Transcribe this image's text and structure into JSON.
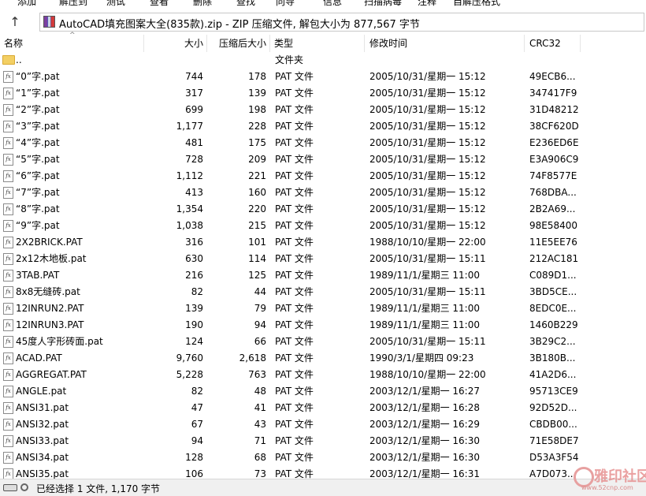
{
  "toolbar": {
    "items": [
      "添加",
      "解压到",
      "测试",
      "查看",
      "删除",
      "查找",
      "向导",
      "信息",
      "扫描病毒",
      "注释",
      "自解压格式"
    ]
  },
  "address": {
    "text": "AutoCAD填充图案大全(835款).zip - ZIP 压缩文件, 解包大小为 877,567 字节"
  },
  "columns": {
    "name": "名称",
    "size": "大小",
    "packed": "压缩后大小",
    "type": "类型",
    "modified": "修改时间",
    "crc": "CRC32"
  },
  "rows": [
    {
      "name": "..",
      "size": "",
      "packed": "",
      "type": "文件夹",
      "modified": "",
      "crc": "",
      "icon": "folder-icon"
    },
    {
      "name": "“0”字.pat",
      "size": "744",
      "packed": "178",
      "type": "PAT 文件",
      "modified": "2005/10/31/星期一 15:12",
      "crc": "49ECB6...",
      "icon": "pat-file-icon"
    },
    {
      "name": "“1”字.pat",
      "size": "317",
      "packed": "139",
      "type": "PAT 文件",
      "modified": "2005/10/31/星期一 15:12",
      "crc": "347417F9",
      "icon": "pat-file-icon"
    },
    {
      "name": "“2”字.pat",
      "size": "699",
      "packed": "198",
      "type": "PAT 文件",
      "modified": "2005/10/31/星期一 15:12",
      "crc": "31D48212",
      "icon": "pat-file-icon"
    },
    {
      "name": "“3”字.pat",
      "size": "1,177",
      "packed": "228",
      "type": "PAT 文件",
      "modified": "2005/10/31/星期一 15:12",
      "crc": "38CF620D",
      "icon": "pat-file-icon"
    },
    {
      "name": "“4”字.pat",
      "size": "481",
      "packed": "175",
      "type": "PAT 文件",
      "modified": "2005/10/31/星期一 15:12",
      "crc": "E236ED6E",
      "icon": "pat-file-icon"
    },
    {
      "name": "“5”字.pat",
      "size": "728",
      "packed": "209",
      "type": "PAT 文件",
      "modified": "2005/10/31/星期一 15:12",
      "crc": "E3A906C9",
      "icon": "pat-file-icon"
    },
    {
      "name": "“6”字.pat",
      "size": "1,112",
      "packed": "221",
      "type": "PAT 文件",
      "modified": "2005/10/31/星期一 15:12",
      "crc": "74F8577E",
      "icon": "pat-file-icon"
    },
    {
      "name": "“7”字.pat",
      "size": "413",
      "packed": "160",
      "type": "PAT 文件",
      "modified": "2005/10/31/星期一 15:12",
      "crc": "768DBA...",
      "icon": "pat-file-icon"
    },
    {
      "name": "“8”字.pat",
      "size": "1,354",
      "packed": "220",
      "type": "PAT 文件",
      "modified": "2005/10/31/星期一 15:12",
      "crc": "2B2A69...",
      "icon": "pat-file-icon"
    },
    {
      "name": "“9”字.pat",
      "size": "1,038",
      "packed": "215",
      "type": "PAT 文件",
      "modified": "2005/10/31/星期一 15:12",
      "crc": "98E58400",
      "icon": "pat-file-icon"
    },
    {
      "name": "2X2BRICK.PAT",
      "size": "316",
      "packed": "101",
      "type": "PAT 文件",
      "modified": "1988/10/10/星期一 22:00",
      "crc": "11E5EE76",
      "icon": "pat-file-icon"
    },
    {
      "name": "2x12木地板.pat",
      "size": "630",
      "packed": "114",
      "type": "PAT 文件",
      "modified": "2005/10/31/星期一 15:11",
      "crc": "212AC181",
      "icon": "pat-file-icon"
    },
    {
      "name": "3TAB.PAT",
      "size": "216",
      "packed": "125",
      "type": "PAT 文件",
      "modified": "1989/11/1/星期三 11:00",
      "crc": "C089D1...",
      "icon": "pat-file-icon"
    },
    {
      "name": "8x8无缝砖.pat",
      "size": "82",
      "packed": "44",
      "type": "PAT 文件",
      "modified": "2005/10/31/星期一 15:11",
      "crc": "3BD5CE...",
      "icon": "pat-file-icon"
    },
    {
      "name": "12INRUN2.PAT",
      "size": "139",
      "packed": "79",
      "type": "PAT 文件",
      "modified": "1989/11/1/星期三 11:00",
      "crc": "8EDC0E...",
      "icon": "pat-file-icon"
    },
    {
      "name": "12INRUN3.PAT",
      "size": "190",
      "packed": "94",
      "type": "PAT 文件",
      "modified": "1989/11/1/星期三 11:00",
      "crc": "1460B229",
      "icon": "pat-file-icon"
    },
    {
      "name": "45度人字形砖面.pat",
      "size": "124",
      "packed": "66",
      "type": "PAT 文件",
      "modified": "2005/10/31/星期一 15:11",
      "crc": "3B29C2...",
      "icon": "pat-file-icon"
    },
    {
      "name": "ACAD.PAT",
      "size": "9,760",
      "packed": "2,618",
      "type": "PAT 文件",
      "modified": "1990/3/1/星期四 09:23",
      "crc": "3B180B...",
      "icon": "pat-file-icon"
    },
    {
      "name": "AGGREGAT.PAT",
      "size": "5,228",
      "packed": "763",
      "type": "PAT 文件",
      "modified": "1988/10/10/星期一 22:00",
      "crc": "41A2D6...",
      "icon": "pat-file-icon"
    },
    {
      "name": "ANGLE.pat",
      "size": "82",
      "packed": "48",
      "type": "PAT 文件",
      "modified": "2003/12/1/星期一 16:27",
      "crc": "95713CE9",
      "icon": "pat-file-icon"
    },
    {
      "name": "ANSI31.pat",
      "size": "47",
      "packed": "41",
      "type": "PAT 文件",
      "modified": "2003/12/1/星期一 16:28",
      "crc": "92D52D...",
      "icon": "pat-file-icon"
    },
    {
      "name": "ANSI32.pat",
      "size": "67",
      "packed": "43",
      "type": "PAT 文件",
      "modified": "2003/12/1/星期一 16:29",
      "crc": "CBDB00...",
      "icon": "pat-file-icon"
    },
    {
      "name": "ANSI33.pat",
      "size": "94",
      "packed": "71",
      "type": "PAT 文件",
      "modified": "2003/12/1/星期一 16:30",
      "crc": "71E58DE7",
      "icon": "pat-file-icon"
    },
    {
      "name": "ANSI34.pat",
      "size": "128",
      "packed": "68",
      "type": "PAT 文件",
      "modified": "2003/12/1/星期一 16:30",
      "crc": "D53A3F54",
      "icon": "pat-file-icon"
    },
    {
      "name": "ANSI35.pat",
      "size": "106",
      "packed": "73",
      "type": "PAT 文件",
      "modified": "2003/12/1/星期一 16:31",
      "crc": "A7D073...",
      "icon": "pat-file-icon"
    }
  ],
  "status": {
    "text": "已经选择 1 文件, 1,170 字节"
  },
  "watermark": {
    "text": "雅印社区",
    "url": "www.52cnp.com"
  }
}
